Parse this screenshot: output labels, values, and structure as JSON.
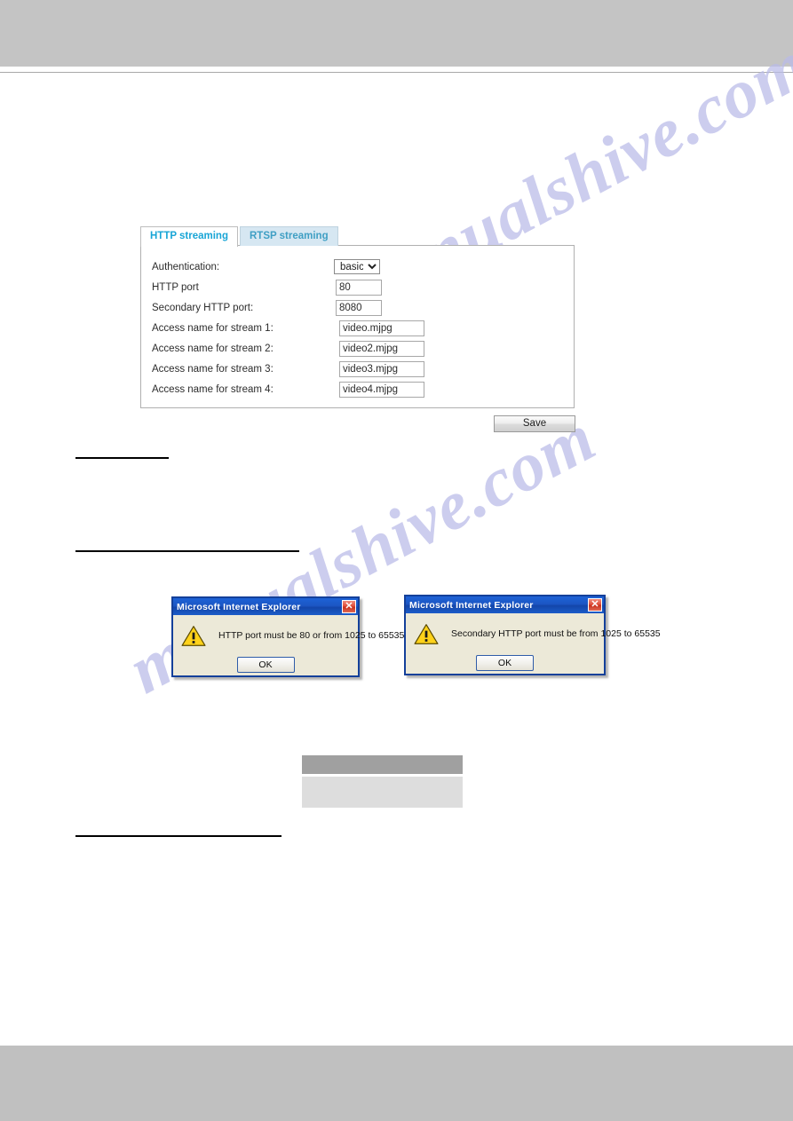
{
  "page": {
    "watermark_text": "manualshive.com"
  },
  "tabs": [
    {
      "label": "HTTP streaming",
      "active": true
    },
    {
      "label": "RTSP streaming",
      "active": false
    }
  ],
  "form": {
    "rows": [
      {
        "label": "Authentication:",
        "type": "select",
        "value": "basic"
      },
      {
        "label": "HTTP port",
        "type": "text",
        "value": "80"
      },
      {
        "label": "Secondary HTTP port:",
        "type": "text",
        "value": "8080"
      },
      {
        "label": "Access name for stream 1:",
        "type": "text",
        "value": "video.mjpg"
      },
      {
        "label": "Access name for stream 2:",
        "type": "text",
        "value": "video2.mjpg"
      },
      {
        "label": "Access name for stream 3:",
        "type": "text",
        "value": "video3.mjpg"
      },
      {
        "label": "Access name for stream 4:",
        "type": "text",
        "value": "video4.mjpg"
      }
    ],
    "auth_options": [
      "basic"
    ],
    "save_label": "Save"
  },
  "dialogs": [
    {
      "title": "Microsoft Internet Explorer",
      "message": "HTTP port must be 80 or from 1025 to 65535",
      "ok_label": "OK",
      "close_label": "✕",
      "icon": "warning-triangle-icon"
    },
    {
      "title": "Microsoft Internet Explorer",
      "message": "Secondary HTTP port must be from 1025 to 65535",
      "ok_label": "OK",
      "close_label": "✕",
      "icon": "warning-triangle-icon"
    }
  ],
  "colors": {
    "tab_active_text": "#18a5d6",
    "tab_inactive_bg": "#d6e7f2",
    "dialog_title_bg": "#1c56c4",
    "dialog_body_bg": "#ece9d8",
    "watermark": "#b9bbe8",
    "band_gray": "#c4c4c4",
    "table_header_gray": "#a0a0a0",
    "table_row_gray": "#dddddd"
  }
}
